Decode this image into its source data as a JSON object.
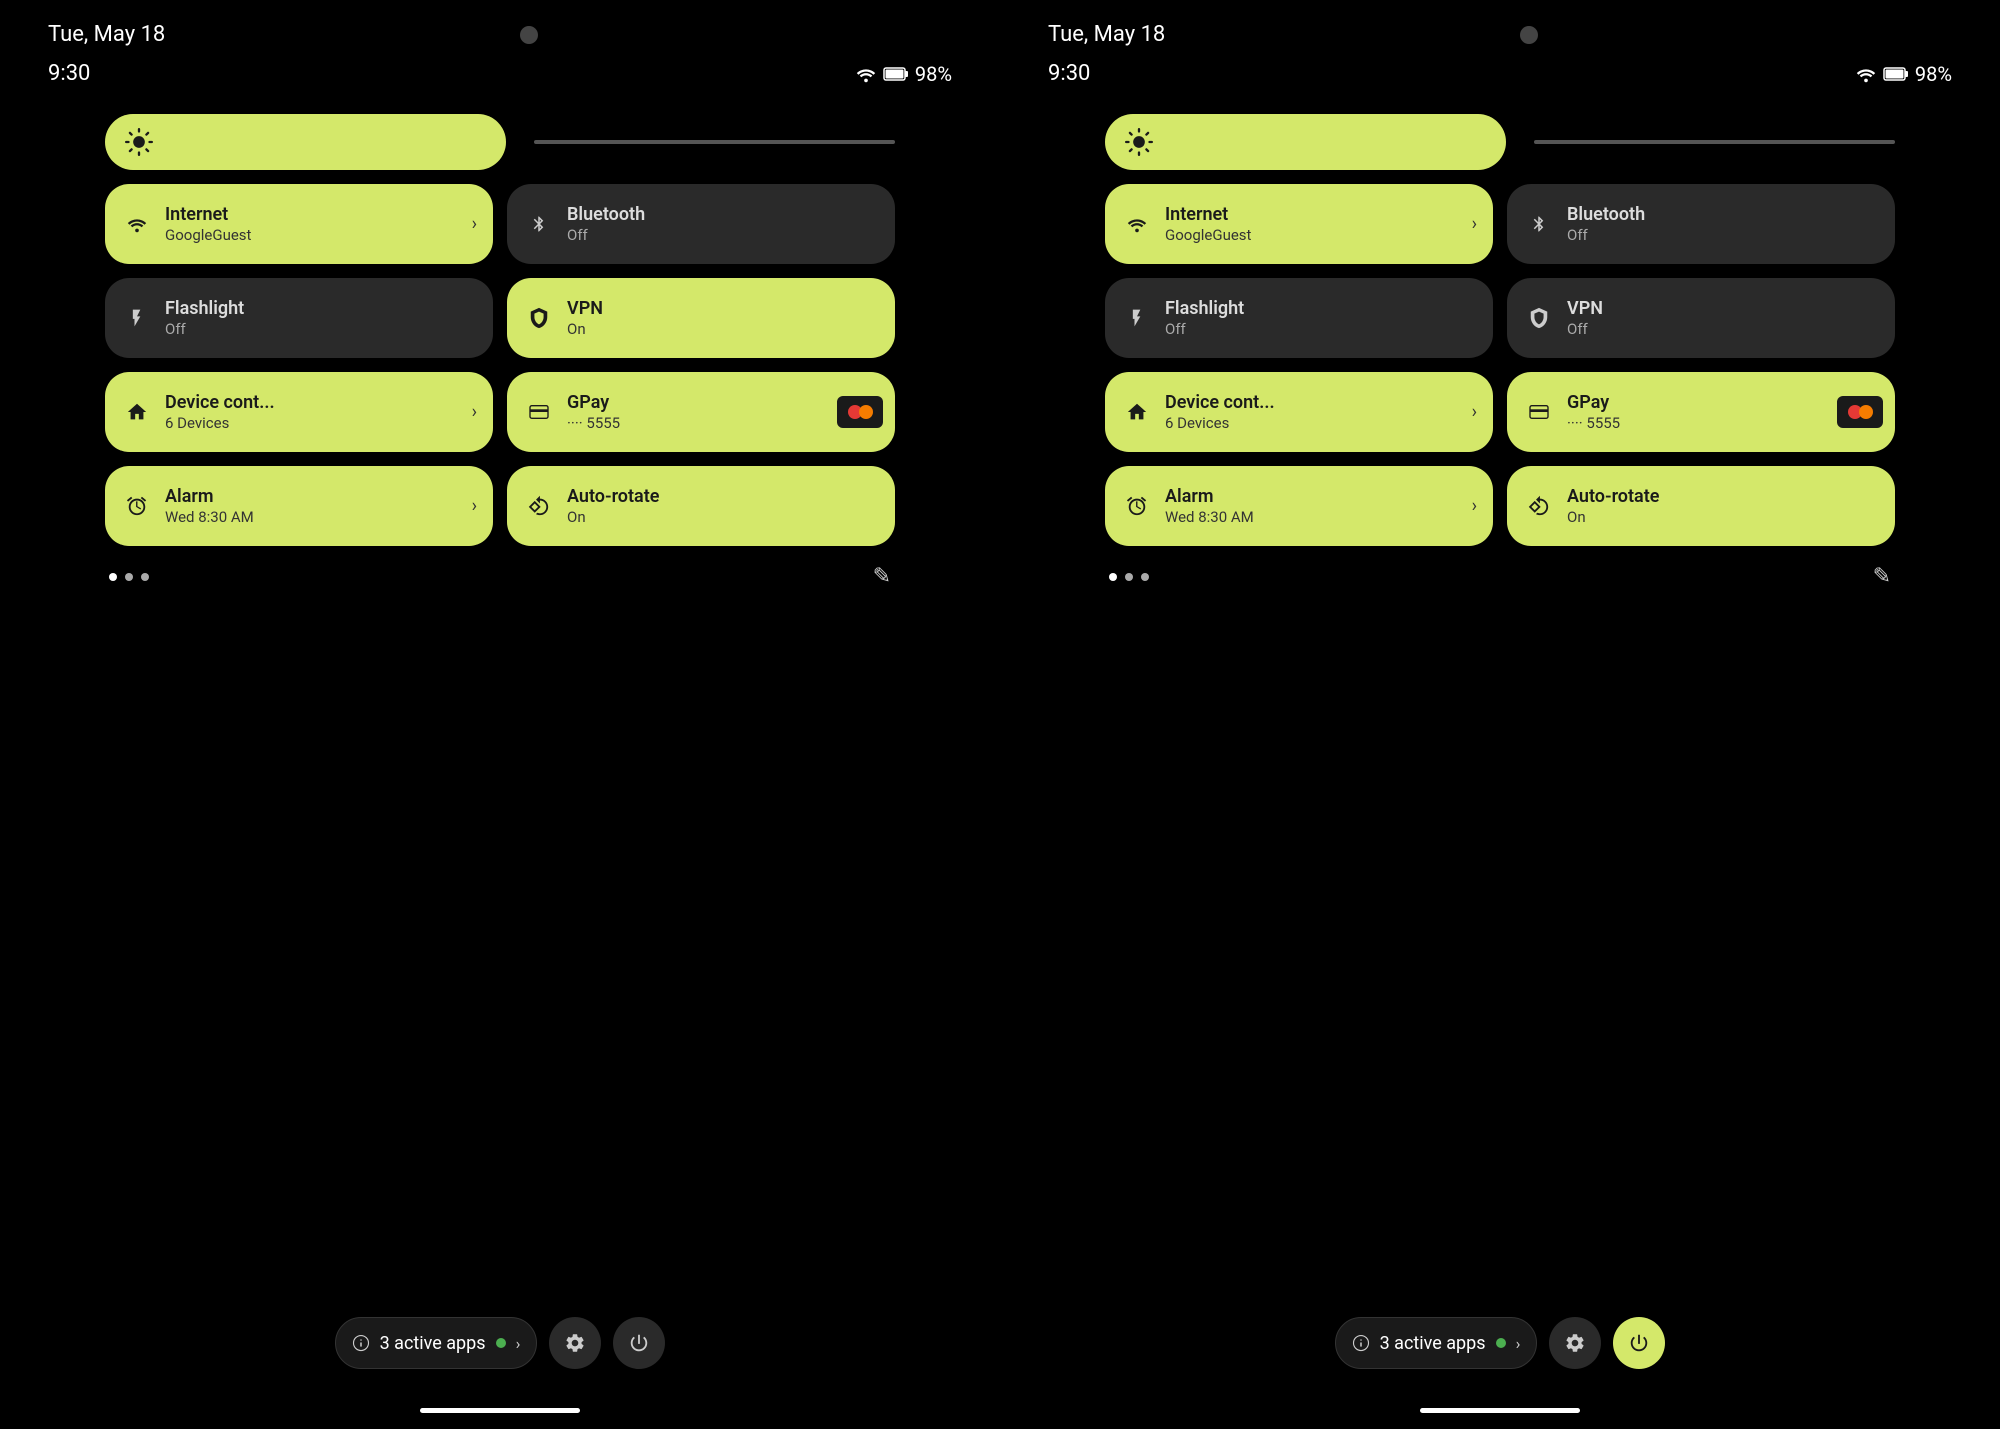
{
  "panel1": {
    "date": "Tue, May 18",
    "time": "9:30",
    "battery": "98%",
    "brightness": {
      "icon": "⚙"
    },
    "tiles": [
      {
        "id": "internet",
        "title": "Internet",
        "subtitle": "GoogleGuest",
        "active": true,
        "icon": "wifi",
        "hasChevron": true,
        "col": 1
      },
      {
        "id": "bluetooth",
        "title": "Bluetooth",
        "subtitle": "Off",
        "active": false,
        "icon": "bluetooth",
        "hasChevron": false,
        "col": 2
      },
      {
        "id": "flashlight",
        "title": "Flashlight",
        "subtitle": "Off",
        "active": false,
        "icon": "flashlight",
        "hasChevron": false,
        "col": 1
      },
      {
        "id": "vpn",
        "title": "VPN",
        "subtitle": "On",
        "active": true,
        "icon": "vpn",
        "hasChevron": false,
        "col": 2
      },
      {
        "id": "device",
        "title": "Device cont...",
        "subtitle": "6 Devices",
        "active": true,
        "icon": "home",
        "hasChevron": true,
        "col": 1
      },
      {
        "id": "gpay",
        "title": "GPay",
        "subtitle": "···· 5555",
        "active": true,
        "icon": "gpay",
        "hasChevron": false,
        "col": 2
      },
      {
        "id": "alarm",
        "title": "Alarm",
        "subtitle": "Wed 8:30 AM",
        "active": true,
        "icon": "alarm",
        "hasChevron": true,
        "col": 1
      },
      {
        "id": "autorotate",
        "title": "Auto-rotate",
        "subtitle": "On",
        "active": true,
        "icon": "rotate",
        "hasChevron": false,
        "col": 2
      }
    ],
    "active_apps": "3 active apps",
    "vpn_active": true,
    "power_active": false
  },
  "panel2": {
    "date": "Tue, May 18",
    "time": "9:30",
    "battery": "98%",
    "tiles": [
      {
        "id": "internet",
        "title": "Internet",
        "subtitle": "GoogleGuest",
        "active": true,
        "icon": "wifi",
        "hasChevron": true
      },
      {
        "id": "bluetooth",
        "title": "Bluetooth",
        "subtitle": "Off",
        "active": false,
        "icon": "bluetooth",
        "hasChevron": false
      },
      {
        "id": "flashlight",
        "title": "Flashlight",
        "subtitle": "Off",
        "active": false,
        "icon": "flashlight",
        "hasChevron": false
      },
      {
        "id": "vpn",
        "title": "VPN",
        "subtitle": "Off",
        "active": false,
        "icon": "vpn",
        "hasChevron": false
      },
      {
        "id": "device",
        "title": "Device cont...",
        "subtitle": "6 Devices",
        "active": true,
        "icon": "home",
        "hasChevron": true
      },
      {
        "id": "gpay",
        "title": "GPay",
        "subtitle": "···· 5555",
        "active": true,
        "icon": "gpay",
        "hasChevron": false
      },
      {
        "id": "alarm",
        "title": "Alarm",
        "subtitle": "Wed 8:30 AM",
        "active": true,
        "icon": "alarm",
        "hasChevron": true
      },
      {
        "id": "autorotate",
        "title": "Auto-rotate",
        "subtitle": "On",
        "active": true,
        "icon": "rotate",
        "hasChevron": false
      }
    ],
    "active_apps": "3 active apps",
    "power_active": true
  }
}
